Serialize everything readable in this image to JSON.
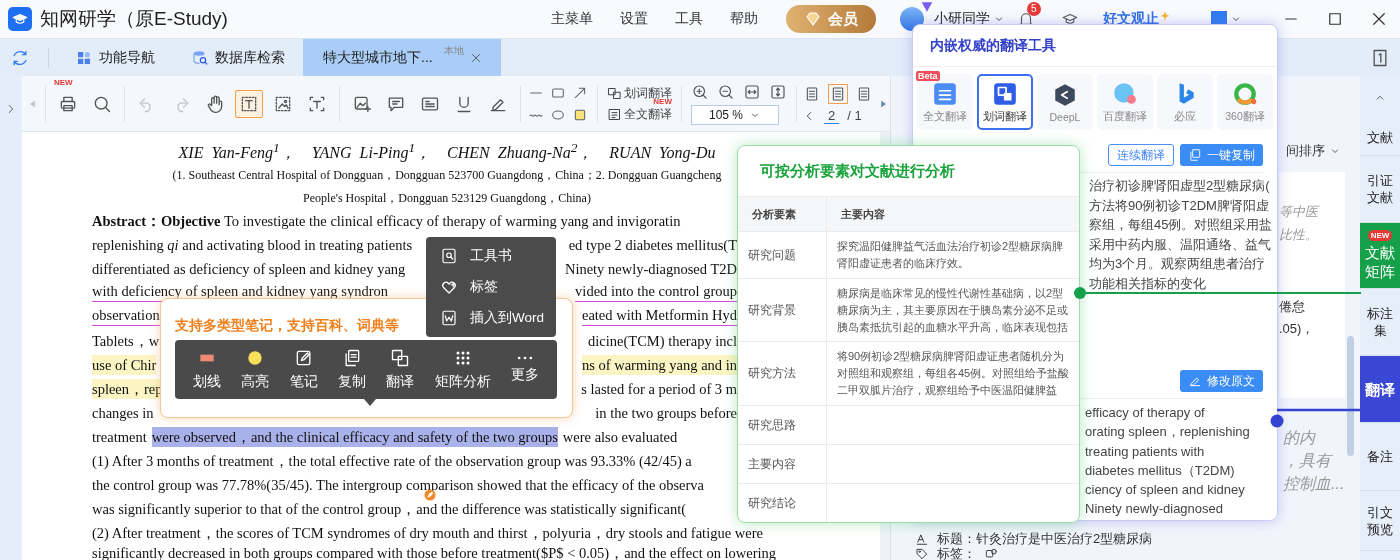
{
  "title_bar": {
    "app_title": "知网研学（原E-Study)",
    "menu": [
      "主菜单",
      "设置",
      "工具",
      "帮助"
    ],
    "vip_button": "会员",
    "user_name": "小研同学",
    "notification_count": "5",
    "promo": "好文观止"
  },
  "tabs": [
    {
      "label": "功能导航",
      "selected": false
    },
    {
      "label": "数据库检索",
      "selected": false
    },
    {
      "label": "特大型城市地下...",
      "badge": "本地",
      "selected": true
    }
  ],
  "toolbar": {
    "tools": [
      {
        "badge": "NEW",
        "selected": false,
        "disabled": false
      },
      {
        "selected": false,
        "disabled": false
      },
      {
        "selected": false,
        "disabled": true
      },
      {
        "selected": false,
        "disabled": true
      },
      {
        "selected": false,
        "disabled": false
      },
      {
        "selected": true,
        "disabled": false
      },
      {
        "selected": false,
        "disabled": false
      },
      {
        "selected": false,
        "disabled": false
      },
      {
        "selected": false,
        "disabled": false
      },
      {
        "selected": false,
        "disabled": false
      },
      {
        "selected": false,
        "disabled": false
      },
      {
        "selected": false,
        "disabled": false
      },
      {
        "selected": false,
        "disabled": false
      }
    ],
    "word_translate": "划词翻译",
    "full_translate": "全文翻译",
    "full_translate_badge": "NEW",
    "zoom": "105 %",
    "view_modes": [
      {
        "selected": false
      },
      {
        "selected": true
      },
      {
        "selected": false
      }
    ],
    "page_current": "2",
    "page_total": "/ 1"
  },
  "document": {
    "lines": [
      {
        "kind": "authors",
        "segments": [
          {
            "text": "XIE Yan-Feng$^{1}$，　YANG Li-Ping$^{1}$，　CHEN Zhuang-Na$^{2}$，　RUAN Yong-Du"
          }
        ]
      },
      {
        "kind": "affiliation",
        "segments": [
          {
            "text": "(1. Southeast Central Hospital of Dongguan，Dongguan 523700 Guangdong，China；2. Dongguan Guangcheng"
          }
        ]
      },
      {
        "kind": "affiliation",
        "segments": [
          {
            "text": "People's Hospital，Dongguan 523129 Guangdong，China)"
          }
        ]
      },
      {
        "kind": "body",
        "segments": [
          {
            "text": "**Abstract：Objective** To investigate the clinical efficacy of therapy of warming yang and invigoratin"
          }
        ]
      },
      {
        "kind": "body",
        "segments": [
          {
            "text": "replenishing *qi* and activating blood in treating patients"
          },
          {
            "text": "ed type 2 diabetes mellitus(T"
          }
        ]
      },
      {
        "kind": "body",
        "segments": [
          {
            "text": "differentiated as deficiency of spleen and kidney yang"
          },
          {
            "text": "Ninety newly-diagnosed T2D"
          }
        ]
      },
      {
        "kind": "body",
        "segments": [
          {
            "text": "with deficiency of spleen and kidney yang syndron",
            "kind": "underlined"
          },
          {
            "text": "vided into the control group",
            "kind": "underlined"
          }
        ]
      },
      {
        "kind": "body",
        "segments": [
          {
            "text": "observation",
            "kind": "underlined"
          },
          {
            "text": "eated with Metformin Hyd",
            "kind": "underlined"
          }
        ]
      },
      {
        "kind": "body",
        "segments": [
          {
            "text": "Tablets，w"
          },
          {
            "text": "dicine(TCM) therapy incl"
          }
        ]
      },
      {
        "kind": "body",
        "segments": [
          {
            "text": "use of Chir",
            "kind": "highlighted"
          },
          {
            "text": "ns of warming yang and in",
            "kind": "highlighted"
          }
        ]
      },
      {
        "kind": "body",
        "segments": [
          {
            "text": "spleen，rep",
            "kind": "highlighted"
          },
          {
            "text": "s lasted for a period of 3 m"
          }
        ]
      },
      {
        "kind": "body",
        "segments": [
          {
            "text": "changes in"
          },
          {
            "text": "in the two groups before"
          }
        ]
      },
      {
        "kind": "body",
        "segments": [
          {
            "text": "treatment"
          },
          {
            "text": "were observed，and the clinical efficacy and safety of the two groups",
            "kind": "selection"
          },
          {
            "text": "were also evaluated"
          }
        ]
      },
      {
        "kind": "body",
        "segments": [
          {
            "text": "(1) After 3 months of treatment，the total effective rate of the observation group was 93.33% (42/45) a"
          }
        ]
      },
      {
        "kind": "body",
        "segments": [
          {
            "text": "the control group was 77.78%(35/45). The intergroup comparison showed that the efficacy of the observa"
          }
        ]
      },
      {
        "kind": "body",
        "segments": [
          {
            "text": "was significantly superior to that of the control group，and the difference was statistically significant("
          }
        ]
      },
      {
        "kind": "wide",
        "segments": [
          {
            "text": "(2) After treatment，the scores of TCM syndromes of dry mouth and thirst，polyuria，dry stools and fatigue were"
          }
        ]
      },
      {
        "kind": "wide",
        "segments": [
          {
            "text": "significantly decreased in both groups compared with those before treatment($P$ < 0.05)，and the effect on lowering"
          }
        ]
      }
    ]
  },
  "context_menu": {
    "items": [
      "工具书",
      "标签",
      "插入到Word"
    ]
  },
  "notes_popup": {
    "title": "支持多类型笔记，支持百科、词典等",
    "actions": [
      "划线",
      "高亮",
      "笔记",
      "复制",
      "翻译",
      "矩阵分析",
      "更多"
    ]
  },
  "analysis_popup": {
    "title": "可按分析要素对文献进行分析",
    "columns": [
      "分析要素",
      "主要内容"
    ],
    "rows": [
      {
        "element": "研究问题",
        "content": "探究温阳健脾益气活血法治疗初诊2型糖尿病脾肾阳虚证患者的临床疗效。"
      },
      {
        "element": "研究背景",
        "content": "糖尿病是临床常见的慢性代谢性基础病，以2型糖尿病为主，其主要原因在于胰岛素分泌不足或胰岛素抵抗引起的血糖水平升高，临床表现包括"
      },
      {
        "element": "研究方法",
        "content": "将90例初诊2型糖尿病脾肾阳虚证患者随机分为对照组和观察组，每组各45例。对照组给予盐酸二甲双胍片治疗，观察组给予中医温阳健脾益"
      },
      {
        "element": "研究思路"
      },
      {
        "element": "主要内容"
      },
      {
        "element": "研究结论"
      }
    ]
  },
  "translation_popup": {
    "title": "内嵌权威的翻译工具",
    "engines": [
      {
        "label": "全文翻译",
        "badge": "Beta",
        "selected": false
      },
      {
        "label": "划词翻译",
        "selected": true
      },
      {
        "label": "DeepL",
        "selected": false
      },
      {
        "label": "百度翻译",
        "selected": false
      },
      {
        "label": "必应",
        "selected": false
      },
      {
        "label": "360翻译",
        "selected": false
      }
    ],
    "continuous_button": "连续翻译",
    "copy_button": "一键复制",
    "source_lines": [
      "治疗初诊脾肾阳虚型2型糖尿病(",
      "方法将90例初诊T2DM脾肾阳虚",
      "察组，每组45例。对照组采用盐",
      "采用中药内服、温阳通络、益气",
      "均为3个月。观察两组患者治疗",
      "功能相关指标的变化"
    ],
    "edit_button": "修改原文",
    "target_lines": [
      "efficacy of therapy of",
      "orating spleen，replenishing",
      "treating patients with",
      "diabetes mellitus（T2DM)",
      "ciency of spleen and kidney",
      "Ninety newly-diagnosed"
    ]
  },
  "side_panel": {
    "sort_label": "间排序",
    "card_lines": [
      "等中医",
      "比性。"
    ],
    "card_lines_2": [
      "倦怠",
      ".05)，"
    ],
    "note_lines": [
      "的内",
      "，具有",
      "控制血..."
    ],
    "title_line": "标题：针灸治疗是中医治疗2型糖尿病",
    "tags_label": "标签："
  },
  "right_sidebar": {
    "items": [
      {
        "label": "文献",
        "selected": false
      },
      {
        "label": "引证文献",
        "selected": false
      },
      {
        "label": "文献矩阵",
        "badge": "NEW",
        "color": "#16a04a",
        "selected": false
      },
      {
        "label": "标注集",
        "selected": false
      },
      {
        "label": "翻译",
        "color": "#3a46d4",
        "selected": true
      },
      {
        "label": "备注",
        "selected": false
      },
      {
        "label": "引文预览",
        "selected": false
      }
    ]
  }
}
